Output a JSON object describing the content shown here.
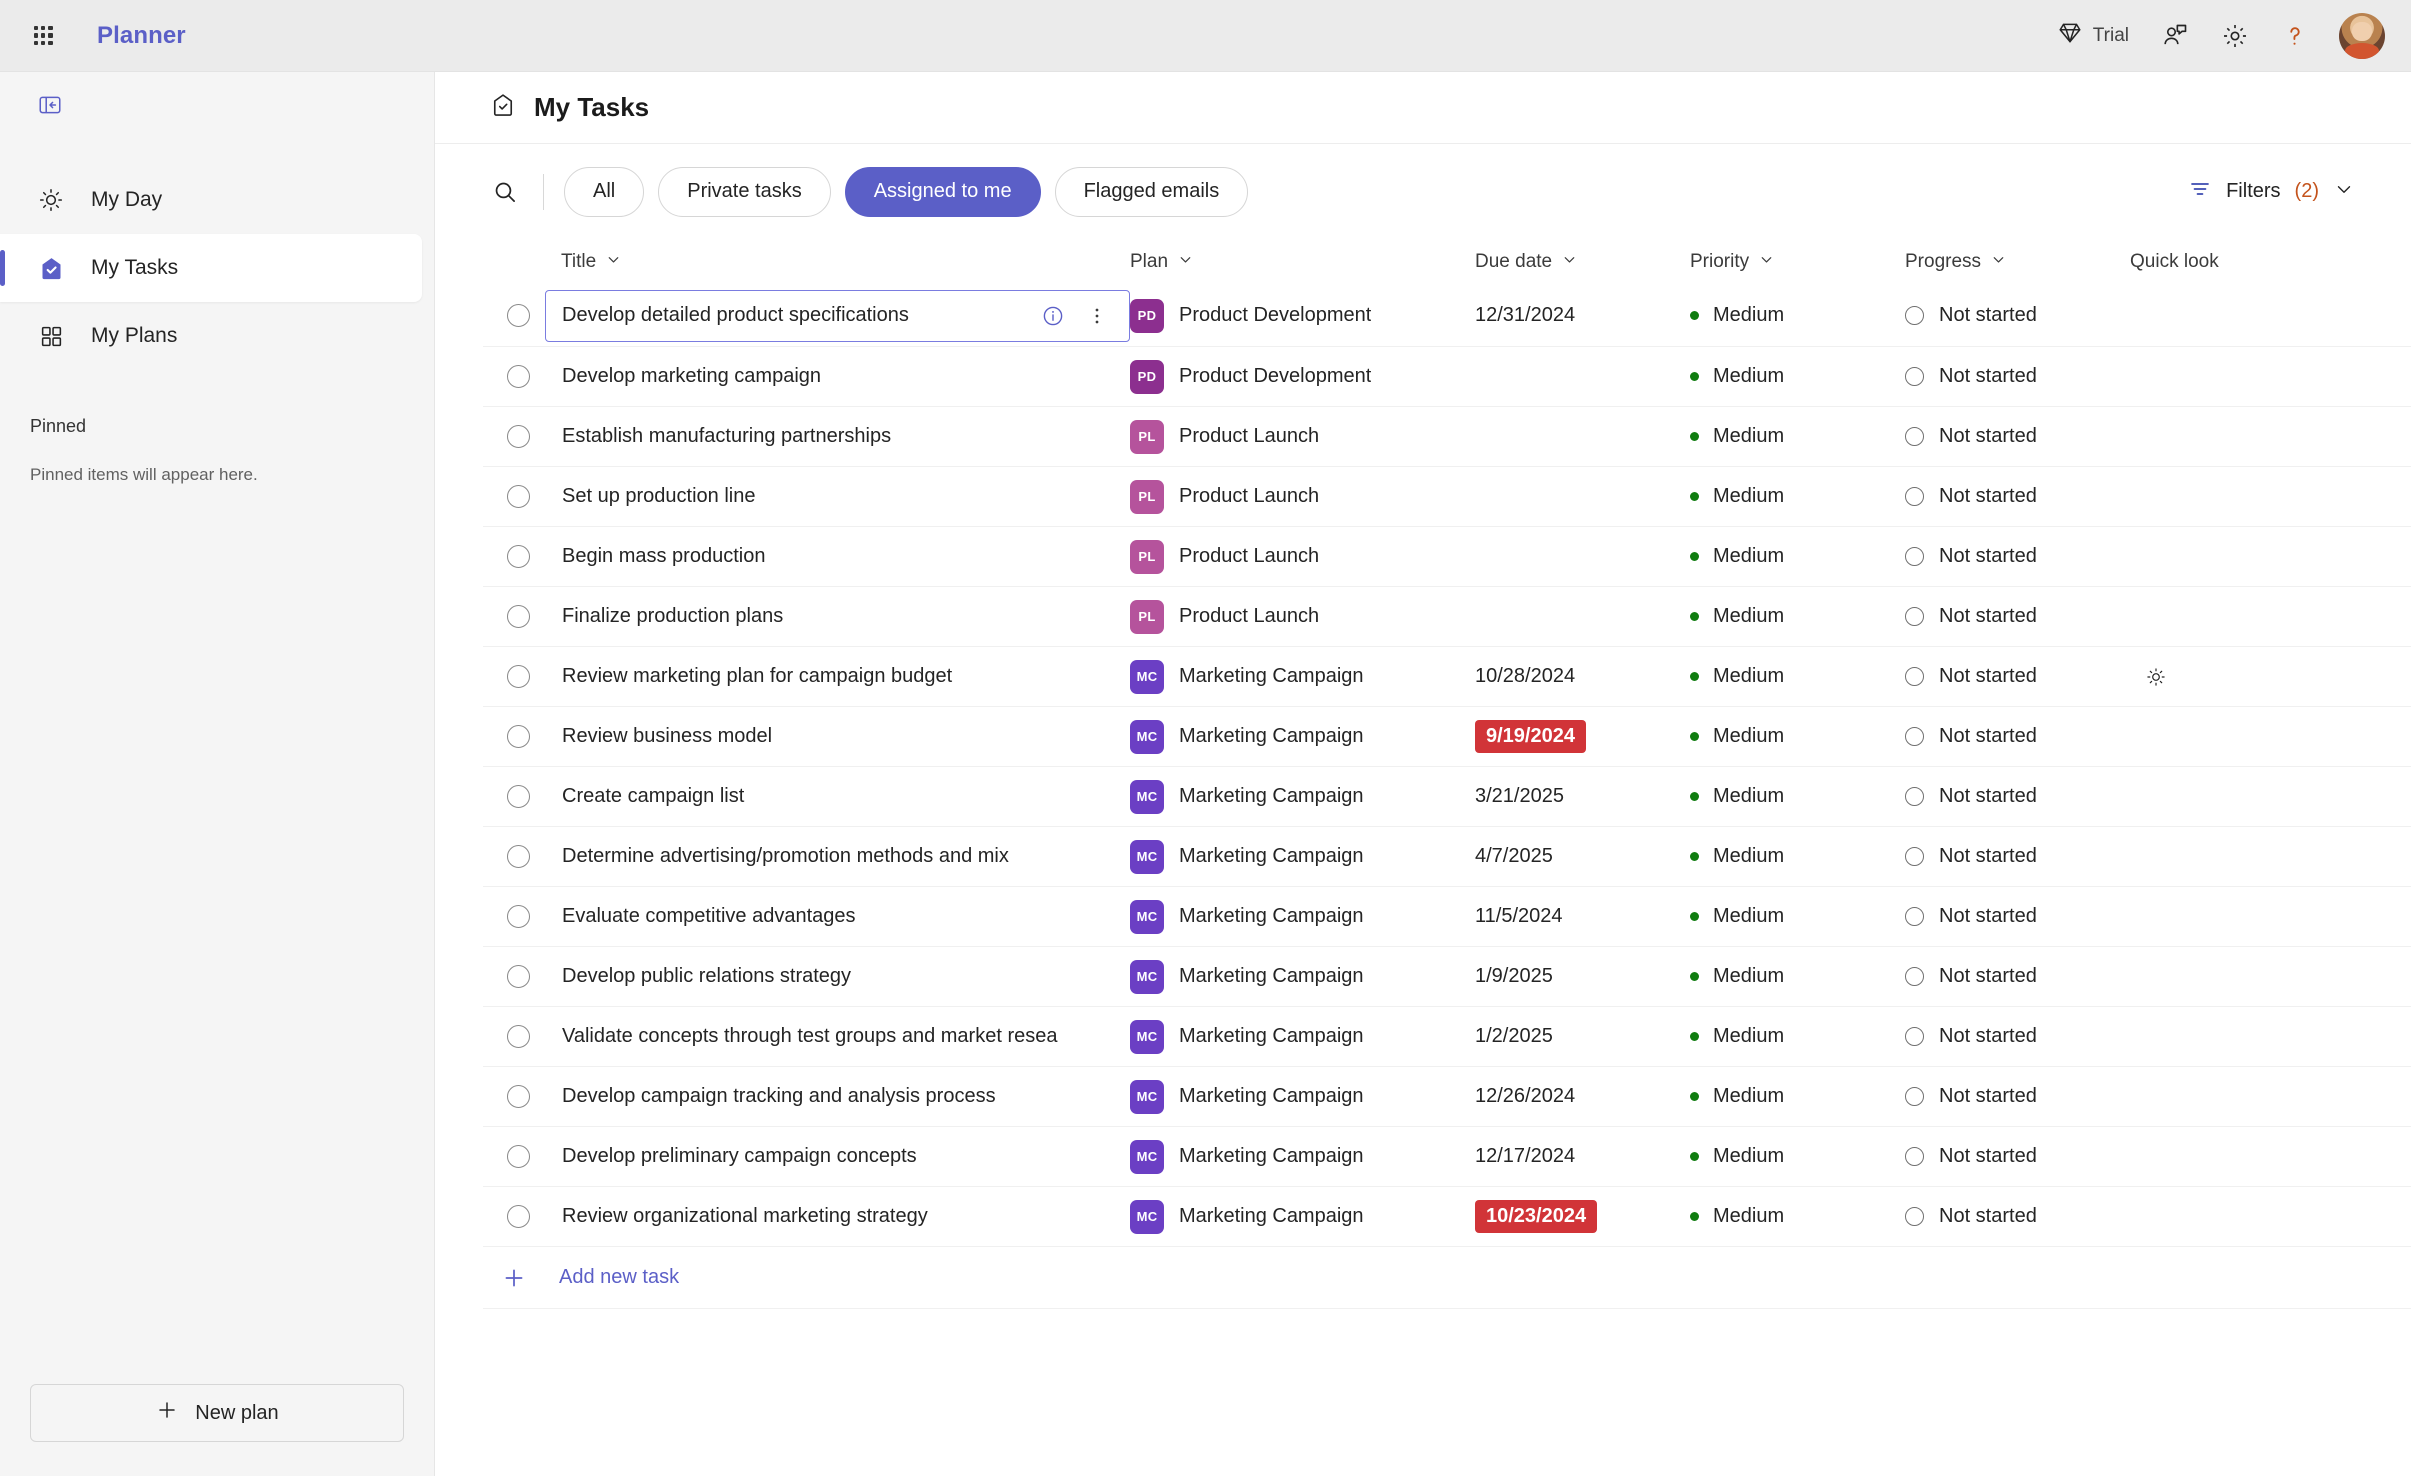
{
  "topbar": {
    "waffle_icon": "app-launcher-icon",
    "app_title": "Planner",
    "trial": {
      "icon": "diamond-icon",
      "label": "Trial"
    },
    "feedback_icon": "feedback-person-icon",
    "settings_icon": "gear-icon",
    "help_icon": "help-question-icon",
    "avatar": "user-avatar"
  },
  "sidebar": {
    "collapse_icon": "collapse-panel-icon",
    "items": [
      {
        "label": "My Day",
        "icon": "sun-icon",
        "active": false
      },
      {
        "label": "My Tasks",
        "icon": "tasks-check-icon",
        "active": true
      },
      {
        "label": "My Plans",
        "icon": "grid-squares-icon",
        "active": false
      }
    ],
    "pinned_heading": "Pinned",
    "pinned_empty": "Pinned items will appear here.",
    "new_plan": {
      "label": "New plan",
      "icon": "plus-icon"
    }
  },
  "page": {
    "title": "My Tasks",
    "title_icon": "tasks-check-outline-icon"
  },
  "toolbar": {
    "search_icon": "search-icon",
    "chips": [
      {
        "label": "All",
        "selected": false
      },
      {
        "label": "Private tasks",
        "selected": false
      },
      {
        "label": "Assigned to me",
        "selected": true
      },
      {
        "label": "Flagged emails",
        "selected": false
      }
    ],
    "filters": {
      "icon": "filter-icon",
      "label": "Filters",
      "count": "(2)",
      "chevron": "chevron-down-icon"
    }
  },
  "table": {
    "columns": [
      {
        "key": "title",
        "label": "Title",
        "sortable": true
      },
      {
        "key": "plan",
        "label": "Plan",
        "sortable": true
      },
      {
        "key": "due",
        "label": "Due date",
        "sortable": true
      },
      {
        "key": "priority",
        "label": "Priority",
        "sortable": true
      },
      {
        "key": "progress",
        "label": "Progress",
        "sortable": true
      },
      {
        "key": "quick",
        "label": "Quick look",
        "sortable": false
      }
    ],
    "rows": [
      {
        "title": "Develop detailed product specifications",
        "plan": "Product Development",
        "plan_initials": "PD",
        "plan_color": "#8c2f8f",
        "due": "12/31/2024",
        "overdue": false,
        "priority": "Medium",
        "priority_color": "#107c10",
        "progress": "Not started",
        "quick": "",
        "focused": true
      },
      {
        "title": "Develop marketing campaign",
        "plan": "Product Development",
        "plan_initials": "PD",
        "plan_color": "#8c2f8f",
        "due": "",
        "overdue": false,
        "priority": "Medium",
        "priority_color": "#107c10",
        "progress": "Not started",
        "quick": "",
        "focused": false
      },
      {
        "title": "Establish manufacturing partnerships",
        "plan": "Product Launch",
        "plan_initials": "PL",
        "plan_color": "#b5539c",
        "due": "",
        "overdue": false,
        "priority": "Medium",
        "priority_color": "#107c10",
        "progress": "Not started",
        "quick": "",
        "focused": false
      },
      {
        "title": "Set up production line",
        "plan": "Product Launch",
        "plan_initials": "PL",
        "plan_color": "#b5539c",
        "due": "",
        "overdue": false,
        "priority": "Medium",
        "priority_color": "#107c10",
        "progress": "Not started",
        "quick": "",
        "focused": false
      },
      {
        "title": "Begin mass production",
        "plan": "Product Launch",
        "plan_initials": "PL",
        "plan_color": "#b5539c",
        "due": "",
        "overdue": false,
        "priority": "Medium",
        "priority_color": "#107c10",
        "progress": "Not started",
        "quick": "",
        "focused": false
      },
      {
        "title": "Finalize production plans",
        "plan": "Product Launch",
        "plan_initials": "PL",
        "plan_color": "#b5539c",
        "due": "",
        "overdue": false,
        "priority": "Medium",
        "priority_color": "#107c10",
        "progress": "Not started",
        "quick": "",
        "focused": false
      },
      {
        "title": "Review marketing plan for campaign budget",
        "plan": "Marketing Campaign",
        "plan_initials": "MC",
        "plan_color": "#6b3fc4",
        "due": "10/28/2024",
        "overdue": false,
        "priority": "Medium",
        "priority_color": "#107c10",
        "progress": "Not started",
        "quick": "add-to-my-day-sun-icon",
        "focused": false
      },
      {
        "title": "Review business model",
        "plan": "Marketing Campaign",
        "plan_initials": "MC",
        "plan_color": "#6b3fc4",
        "due": "9/19/2024",
        "overdue": true,
        "priority": "Medium",
        "priority_color": "#107c10",
        "progress": "Not started",
        "quick": "",
        "focused": false
      },
      {
        "title": "Create campaign list",
        "plan": "Marketing Campaign",
        "plan_initials": "MC",
        "plan_color": "#6b3fc4",
        "due": "3/21/2025",
        "overdue": false,
        "priority": "Medium",
        "priority_color": "#107c10",
        "progress": "Not started",
        "quick": "",
        "focused": false
      },
      {
        "title": "Determine advertising/promotion methods and mix",
        "plan": "Marketing Campaign",
        "plan_initials": "MC",
        "plan_color": "#6b3fc4",
        "due": "4/7/2025",
        "overdue": false,
        "priority": "Medium",
        "priority_color": "#107c10",
        "progress": "Not started",
        "quick": "",
        "focused": false
      },
      {
        "title": "Evaluate competitive advantages",
        "plan": "Marketing Campaign",
        "plan_initials": "MC",
        "plan_color": "#6b3fc4",
        "due": "11/5/2024",
        "overdue": false,
        "priority": "Medium",
        "priority_color": "#107c10",
        "progress": "Not started",
        "quick": "",
        "focused": false
      },
      {
        "title": "Develop public relations strategy",
        "plan": "Marketing Campaign",
        "plan_initials": "MC",
        "plan_color": "#6b3fc4",
        "due": "1/9/2025",
        "overdue": false,
        "priority": "Medium",
        "priority_color": "#107c10",
        "progress": "Not started",
        "quick": "",
        "focused": false
      },
      {
        "title": "Validate concepts through test groups and market resea",
        "plan": "Marketing Campaign",
        "plan_initials": "MC",
        "plan_color": "#6b3fc4",
        "due": "1/2/2025",
        "overdue": false,
        "priority": "Medium",
        "priority_color": "#107c10",
        "progress": "Not started",
        "quick": "",
        "focused": false
      },
      {
        "title": "Develop campaign tracking and analysis process",
        "plan": "Marketing Campaign",
        "plan_initials": "MC",
        "plan_color": "#6b3fc4",
        "due": "12/26/2024",
        "overdue": false,
        "priority": "Medium",
        "priority_color": "#107c10",
        "progress": "Not started",
        "quick": "",
        "focused": false
      },
      {
        "title": "Develop preliminary campaign concepts",
        "plan": "Marketing Campaign",
        "plan_initials": "MC",
        "plan_color": "#6b3fc4",
        "due": "12/17/2024",
        "overdue": false,
        "priority": "Medium",
        "priority_color": "#107c10",
        "progress": "Not started",
        "quick": "",
        "focused": false
      },
      {
        "title": "Review organizational marketing strategy",
        "plan": "Marketing Campaign",
        "plan_initials": "MC",
        "plan_color": "#6b3fc4",
        "due": "10/23/2024",
        "overdue": true,
        "priority": "Medium",
        "priority_color": "#107c10",
        "progress": "Not started",
        "quick": "",
        "focused": false
      }
    ],
    "add_task_label": "Add new task",
    "row_info_icon": "info-circle-icon",
    "row_more_icon": "more-vertical-icon"
  },
  "colors": {
    "accent": "#5b5fc7",
    "overdue": "#d13438",
    "priority_medium": "#107c10"
  }
}
